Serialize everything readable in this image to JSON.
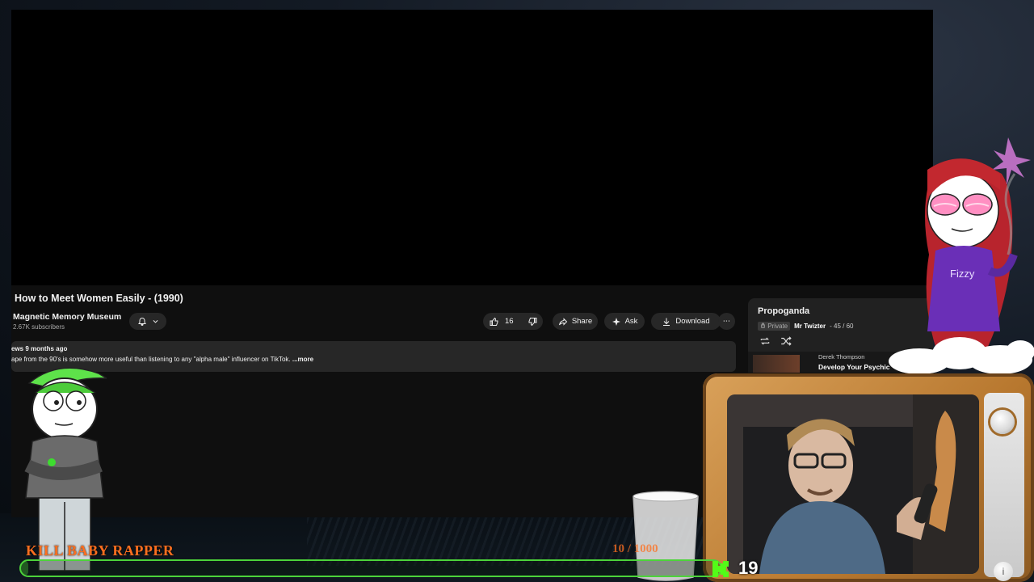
{
  "video": {
    "title": "How to Meet Women Easily - (1990)",
    "channel_name": "Magnetic Memory Museum",
    "subscribers": "2.67K subscribers",
    "likes": "16",
    "share_label": "Share",
    "ask_label": "Ask",
    "download_label": "Download",
    "more_label": "⋯",
    "description_meta": "ews  9 months ago",
    "description_text": "ape from the 90's is somehow more useful than listening to any \"alpha male\" influencer on TikTok.",
    "description_more": " ...more"
  },
  "playlist": {
    "title": "Propoganda",
    "privacy": "Private",
    "owner": "Mr Twizter",
    "position": "- 45 / 60",
    "current_item_channel": "Derek Thompson",
    "current_item_title": "Develop Your Psychic"
  },
  "overlay": {
    "character_name": "Fizzy",
    "goal_label": "KILL BABY RAPPER",
    "goal_progress_text": "10  /  1000",
    "goal_fraction": 0.01,
    "viewer_count": "19"
  },
  "colors": {
    "goal_text": "#ff6f1f",
    "goal_bar": "#4cd33a",
    "yt_background": "#0f0f0f"
  }
}
